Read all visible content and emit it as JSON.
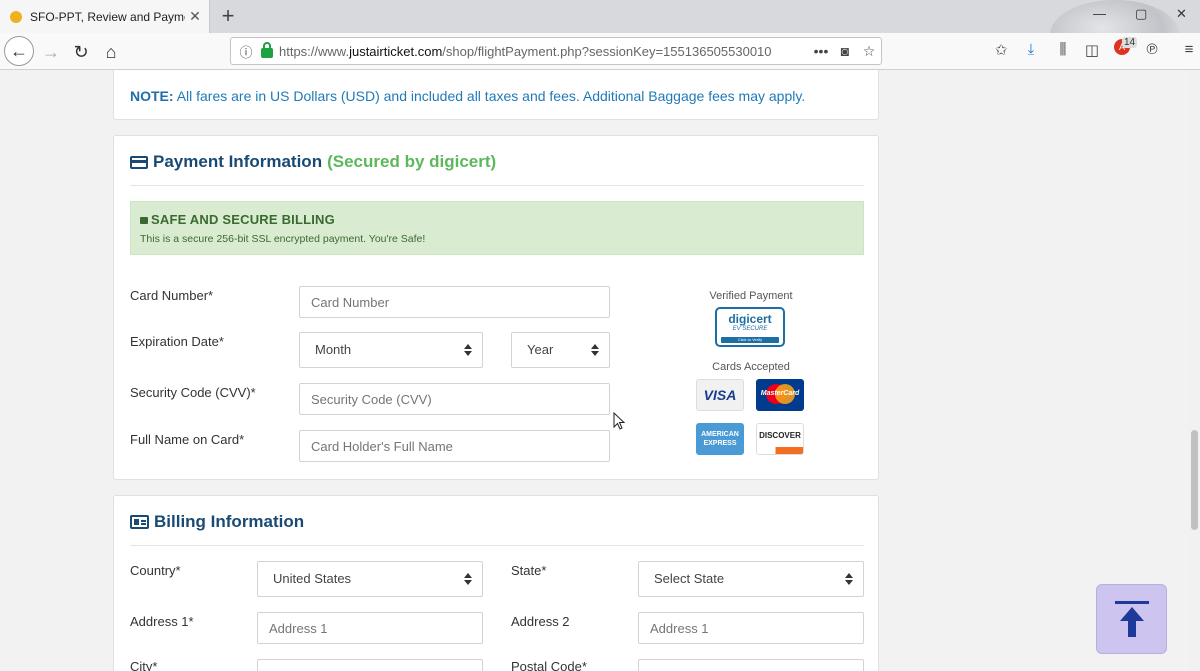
{
  "browser": {
    "tab_title": "SFO-PPT, Review and Payment",
    "url_prefix": "https://www.",
    "url_domain": "justairticket.com",
    "url_path": "/shop/flightPayment.php?sessionKey=155136505530010",
    "badge_count": "14"
  },
  "note": {
    "label": "NOTE:",
    "text": "All fares are in US Dollars (USD) and included all taxes and fees. Additional Baggage fees may apply."
  },
  "payment": {
    "title": "Payment Information",
    "secured": "(Secured by digicert)",
    "alert_title": "SAFE AND SECURE BILLING",
    "alert_msg": "This is a secure 256-bit SSL encrypted payment. You're Safe!",
    "card_number_label": "Card Number*",
    "card_number_placeholder": "Card Number",
    "expiration_label": "Expiration Date*",
    "month_value": "Month",
    "year_value": "Year",
    "cvv_label": "Security Code (CVV)*",
    "cvv_placeholder": "Security Code (CVV)",
    "name_label": "Full Name on Card*",
    "name_placeholder": "Card Holder's Full Name",
    "verified_label": "Verified Payment",
    "digicert_brand": "digicert",
    "digicert_ev": "EV SECURE",
    "digicert_click": "Click to Verify",
    "cards_label": "Cards Accepted",
    "cards": {
      "visa": "VISA",
      "mastercard": "MasterCard",
      "amex": "AMERICAN EXPRESS",
      "discover": "DISCOVER"
    }
  },
  "billing": {
    "title": "Billing Information",
    "country_label": "Country*",
    "country_value": "United States",
    "state_label": "State*",
    "state_value": "Select State",
    "address1_label": "Address 1*",
    "address1_placeholder": "Address 1",
    "address2_label": "Address 2",
    "address2_placeholder": "Address 1",
    "city_label": "City*",
    "postal_label": "Postal Code*"
  }
}
